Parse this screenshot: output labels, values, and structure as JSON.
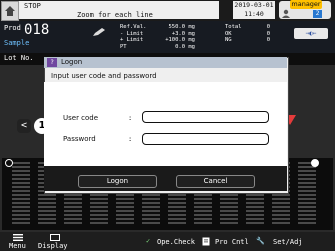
{
  "header": {
    "status": "STOP",
    "status_sub": "Zoom for each line",
    "date": "2019-03-01",
    "time": "11:40",
    "user_label": "manager",
    "user_level": "2"
  },
  "product": {
    "prefix": "Prod",
    "number": "018",
    "name": "Sample",
    "lot_label": "Lot No."
  },
  "values": [
    {
      "label": "Ref.Val.",
      "value": "550.0 mg"
    },
    {
      "label": "- Limit",
      "value": "+3.0 mg"
    },
    {
      "label": "+ Limit",
      "value": "+100.0 mg"
    },
    {
      "label": "PT",
      "value": "0.0 mg"
    }
  ],
  "totals": [
    {
      "label": "Total",
      "value": "0"
    },
    {
      "label": "OK",
      "value": "0"
    },
    {
      "label": "NG",
      "value": "0"
    }
  ],
  "side_button": "⇒◐⇐",
  "left_arrow": "<",
  "channel_number": "1",
  "dialog": {
    "title": "Logon",
    "message": "Input user code and password",
    "user_code_label": "User code",
    "password_label": "Password",
    "colon": ":",
    "logon_button": "Logon",
    "cancel_button": "Cancel"
  },
  "bottom": {
    "menu": "Menu",
    "display": "Display",
    "ope_check": "Ope.Check",
    "pro_cntl": "Pro Cntl",
    "set_adj": "Set/Adj"
  }
}
